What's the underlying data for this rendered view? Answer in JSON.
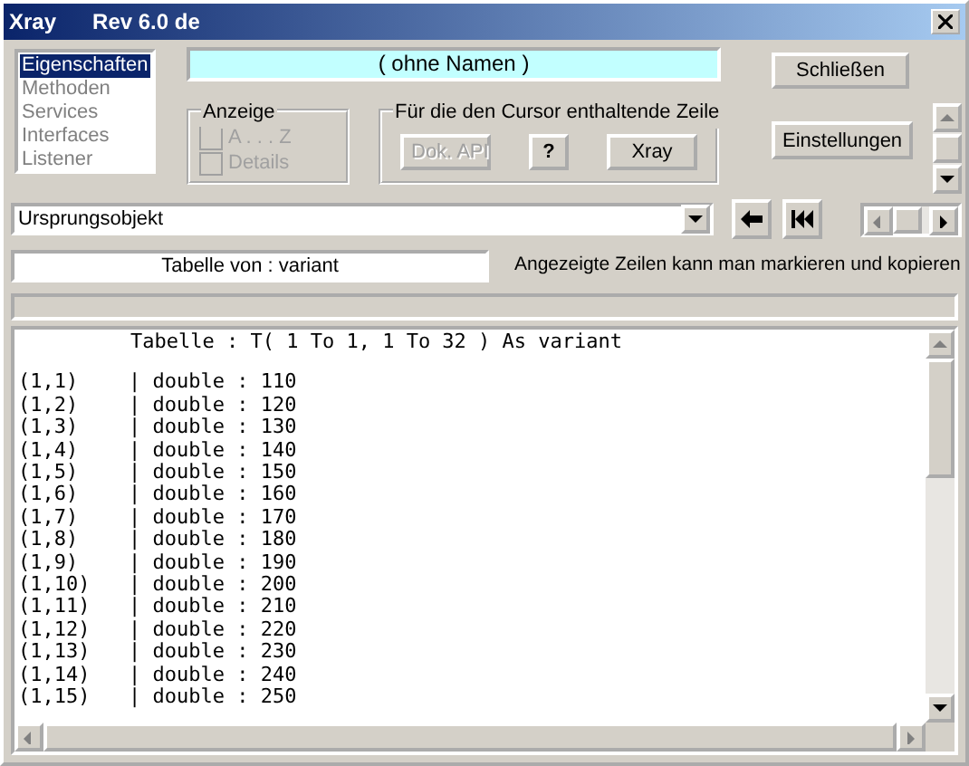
{
  "window": {
    "title": "Xray",
    "subtitle": "Rev 6.0 de"
  },
  "views": [
    {
      "label": "Eigenschaften",
      "selected": true,
      "disabled": false
    },
    {
      "label": "Methoden",
      "selected": false,
      "disabled": true
    },
    {
      "label": "Services",
      "selected": false,
      "disabled": true
    },
    {
      "label": "Interfaces",
      "selected": false,
      "disabled": true
    },
    {
      "label": "Listener",
      "selected": false,
      "disabled": true
    }
  ],
  "name_field": {
    "value": "( ohne Namen )"
  },
  "close_button": "Schließen",
  "settings_button": "Einstellungen",
  "display_group": {
    "title": "Anzeige",
    "options": [
      {
        "label": "A . . . Z",
        "checked": false,
        "disabled": true
      },
      {
        "label": "Details",
        "checked": false,
        "disabled": true
      }
    ]
  },
  "cursor_group": {
    "title": "Für die den Cursor enthaltende Zeile",
    "buttons": [
      {
        "label": "Dok. API",
        "disabled": true
      },
      {
        "label": "?",
        "disabled": false
      },
      {
        "label": "Xray",
        "disabled": false
      }
    ]
  },
  "origin_combo": {
    "value": "Ursprungsobjekt"
  },
  "table_field": {
    "value": "Tabelle von : variant"
  },
  "hint": "Angezeigte Zeilen kann man markieren und kopieren",
  "output": {
    "header": "Tabelle : T( 1 To 1, 1 To 32 ) As variant",
    "rows": [
      {
        "index": "(1,1)",
        "value": "| double : 110"
      },
      {
        "index": "(1,2)",
        "value": "| double : 120"
      },
      {
        "index": "(1,3)",
        "value": "| double : 130"
      },
      {
        "index": "(1,4)",
        "value": "| double : 140"
      },
      {
        "index": "(1,5)",
        "value": "| double : 150"
      },
      {
        "index": "(1,6)",
        "value": "| double : 160"
      },
      {
        "index": "(1,7)",
        "value": "| double : 170"
      },
      {
        "index": "(1,8)",
        "value": "| double : 180"
      },
      {
        "index": "(1,9)",
        "value": "| double : 190"
      },
      {
        "index": "(1,10)",
        "value": "| double : 200"
      },
      {
        "index": "(1,11)",
        "value": "| double : 210"
      },
      {
        "index": "(1,12)",
        "value": "| double : 220"
      },
      {
        "index": "(1,13)",
        "value": "| double : 230"
      },
      {
        "index": "(1,14)",
        "value": "| double : 240"
      },
      {
        "index": "(1,15)",
        "value": "| double : 250"
      }
    ]
  }
}
